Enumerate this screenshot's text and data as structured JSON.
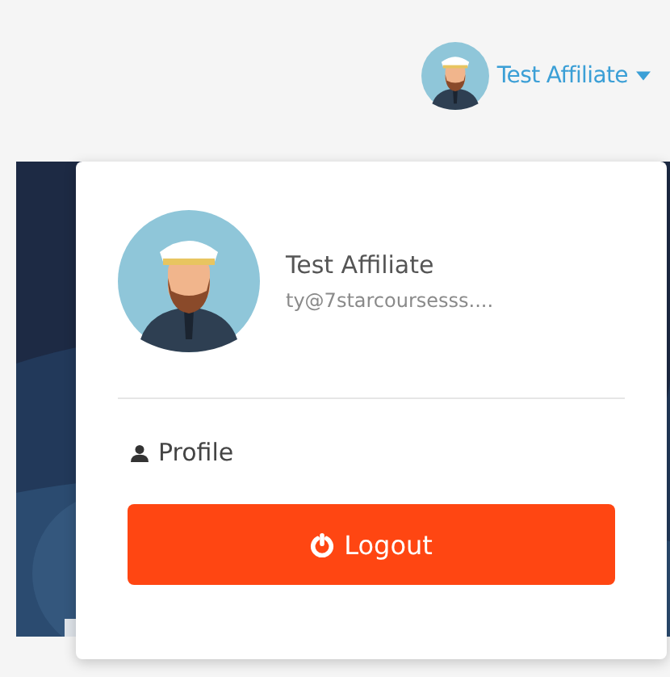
{
  "navbar": {
    "user_name": "Test Affiliate"
  },
  "dropdown": {
    "name": "Test Affiliate",
    "email": "ty@7starcoursesss....",
    "items": [
      {
        "kind": "link",
        "label": "Profile"
      },
      {
        "kind": "button",
        "label": "Logout"
      }
    ]
  }
}
